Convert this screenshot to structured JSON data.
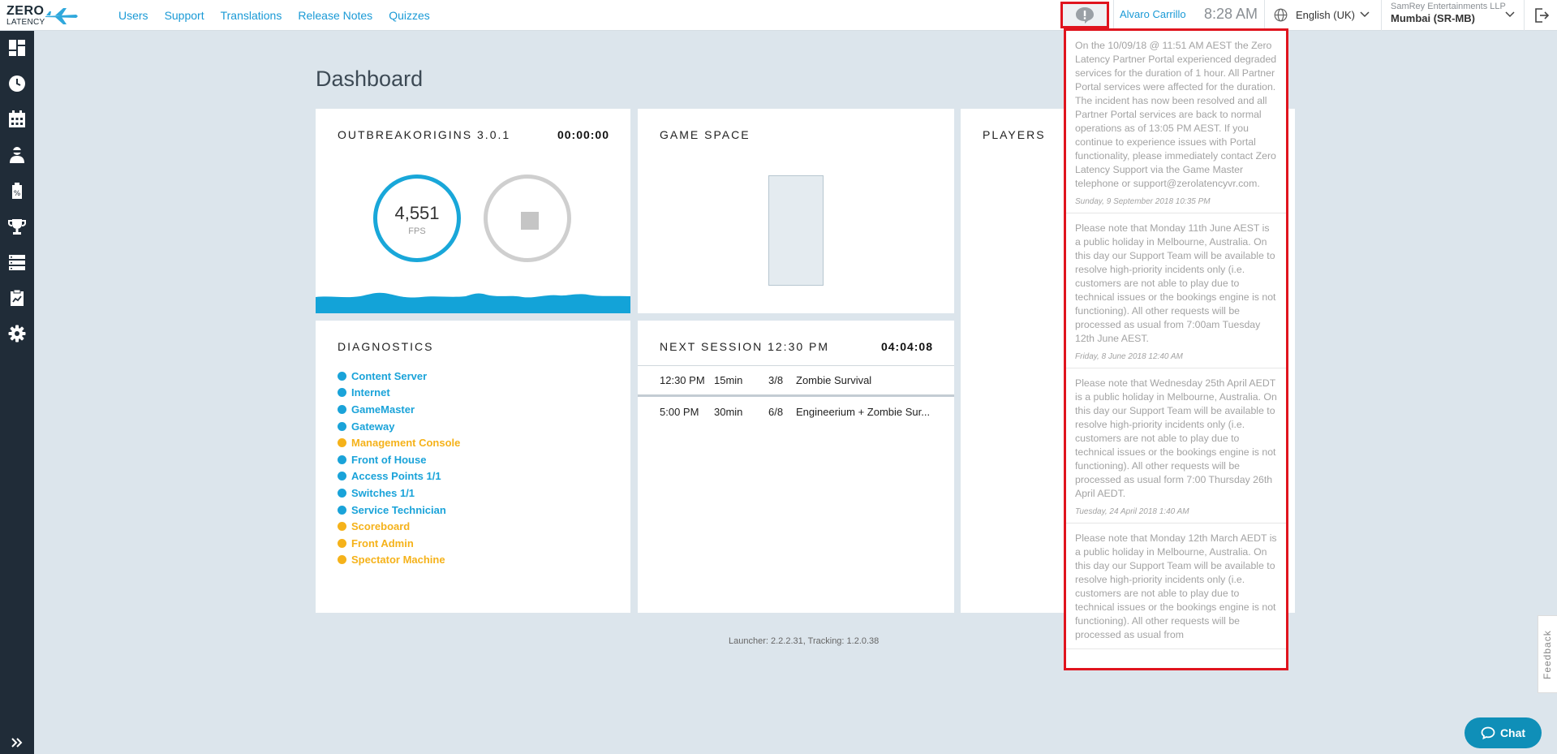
{
  "logo": {
    "line1": "ZERO",
    "line2": "LATENCY"
  },
  "nav": [
    "Users",
    "Support",
    "Translations",
    "Release Notes",
    "Quizzes"
  ],
  "header": {
    "user": "Alvaro Carrillo",
    "time": "8:28 AM",
    "language": "English (UK)",
    "org_name": "SamRey Entertainments LLP",
    "org_site": "Mumbai (SR-MB)"
  },
  "sidebar": {
    "icons": [
      "dashboard-icon",
      "clock-icon",
      "calendar-icon",
      "player-icon",
      "tag-icon",
      "trophy-icon",
      "server-icon",
      "clipboard-icon",
      "gear-icon"
    ]
  },
  "dashboard": {
    "title": "Dashboard",
    "game_card": {
      "title": "OUTBREAKORIGINS 3.0.1",
      "timer": "00:00:00",
      "fps": "4,551",
      "fps_label": "FPS"
    },
    "game_space": {
      "title": "GAME SPACE"
    },
    "players": {
      "title": "PLAYERS"
    },
    "diagnostics": {
      "title": "DIAGNOSTICS",
      "items": [
        {
          "label": "Content Server",
          "status": "ok"
        },
        {
          "label": "Internet",
          "status": "ok"
        },
        {
          "label": "GameMaster",
          "status": "ok"
        },
        {
          "label": "Gateway",
          "status": "ok"
        },
        {
          "label": "Management Console",
          "status": "warn"
        },
        {
          "label": "Front of House",
          "status": "ok"
        },
        {
          "label": "Access Points 1/1",
          "status": "ok"
        },
        {
          "label": "Switches 1/1",
          "status": "ok"
        },
        {
          "label": "Service Technician",
          "status": "ok"
        },
        {
          "label": "Scoreboard",
          "status": "warn"
        },
        {
          "label": "Front Admin",
          "status": "warn"
        },
        {
          "label": "Spectator Machine",
          "status": "warn"
        }
      ]
    },
    "next_session": {
      "title": "NEXT SESSION 12:30 PM",
      "timer": "04:04:08",
      "rows": [
        {
          "time": "12:30 PM",
          "duration": "15min",
          "players": "3/8",
          "game": "Zombie Survival"
        },
        {
          "time": "5:00 PM",
          "duration": "30min",
          "players": "6/8",
          "game": "Engineerium + Zombie Sur..."
        }
      ]
    },
    "version": "Launcher: 2.2.2.31, Tracking: 1.2.0.38"
  },
  "colors": {
    "ok": "#1aa3d9",
    "warn": "#f5b21a",
    "alert_border": "#e0141e"
  },
  "notifications": [
    {
      "text": "On the 10/09/18 @ 11:51 AM AEST the Zero Latency Partner Portal experienced degraded services for the duration of 1 hour. All Partner Portal services were affected for the duration. The incident has now been resolved and all Partner Portal services are back to normal operations as of 13:05 PM AEST. If you continue to experience issues with Portal functionality, please immediately contact Zero Latency Support via the Game Master telephone or support@zerolatencyvr.com.",
      "date": "Sunday, 9 September 2018 10:35 PM"
    },
    {
      "text": "Please note that Monday 11th June AEST is a public holiday in Melbourne, Australia. On this day our Support Team will be available to resolve high-priority incidents only (i.e. customers are not able to play due to technical issues or the bookings engine is not functioning). All other requests will be processed as usual from 7:00am Tuesday 12th June AEST.",
      "date": "Friday, 8 June 2018 12:40 AM"
    },
    {
      "text": "Please note that Wednesday 25th April AEDT is a public holiday in Melbourne, Australia. On this day our Support Team will be available to resolve high-priority incidents only (i.e. customers are not able to play due to technical issues or the bookings engine is not functioning). All other requests will be processed as usual form 7:00 Thursday 26th April AEDT.",
      "date": "Tuesday, 24 April 2018 1:40 AM"
    },
    {
      "text": "Please note that Monday 12th March AEDT is a public holiday in Melbourne, Australia. On this day our Support Team will be available to resolve high-priority incidents only (i.e. customers are not able to play due to technical issues or the bookings engine is not functioning). All other requests will be processed as usual from",
      "date": ""
    }
  ],
  "feedback_label": "Feedback",
  "chat_label": "Chat"
}
